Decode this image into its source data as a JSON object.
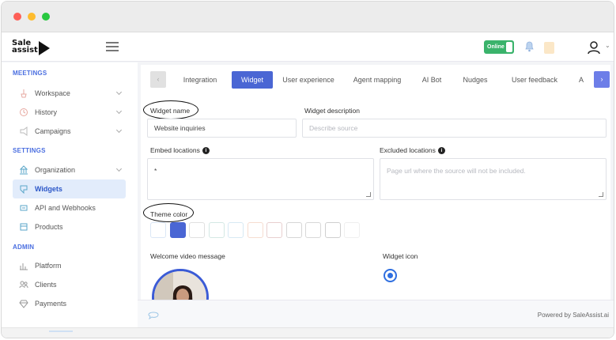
{
  "app": {
    "logo_text": "Sale assist"
  },
  "topbar": {
    "status_label": "Online"
  },
  "sidebar": {
    "sections": [
      {
        "title": "MEETINGS",
        "items": [
          {
            "label": "Workspace",
            "icon": "workspace-icon"
          },
          {
            "label": "History",
            "icon": "history-icon"
          },
          {
            "label": "Campaigns",
            "icon": "campaigns-icon"
          }
        ]
      },
      {
        "title": "SETTINGS",
        "items": [
          {
            "label": "Organization",
            "icon": "organization-icon"
          },
          {
            "label": "Widgets",
            "icon": "widgets-icon"
          },
          {
            "label": "API and Webhooks",
            "icon": "api-icon"
          },
          {
            "label": "Products",
            "icon": "products-icon"
          }
        ]
      },
      {
        "title": "ADMIN",
        "items": [
          {
            "label": "Platform",
            "icon": "platform-icon"
          },
          {
            "label": "Clients",
            "icon": "clients-icon"
          },
          {
            "label": "Payments",
            "icon": "payments-icon"
          }
        ]
      }
    ]
  },
  "tabs": [
    "Integration",
    "Widget",
    "User experience",
    "Agent mapping",
    "AI Bot",
    "Nudges",
    "User feedback",
    "A"
  ],
  "tabs_nav": {
    "prev": "‹",
    "next": "›"
  },
  "form": {
    "widget_name_label": "Widget name",
    "widget_name_value": "Website inquiries",
    "widget_description_label": "Widget description",
    "widget_description_placeholder": "Describe source",
    "embed_locations_label": "Embed locations",
    "embed_locations_value": "*",
    "excluded_locations_label": "Excluded locations",
    "excluded_locations_placeholder": "Page url where the source will not be included.",
    "theme_color_label": "Theme color",
    "theme_colors": [
      "#dbe7f6",
      "#4a66d4",
      "#e0e0e0",
      "#d4e8e4",
      "#d7e9f4",
      "#f6ddd0",
      "#e8cfcf",
      "#d6d6d6",
      "#d8d8d8",
      "#cfcfcf",
      "#efefef"
    ],
    "welcome_video_label": "Welcome video message",
    "widget_icon_label": "Widget icon",
    "info_glyph": "i"
  },
  "footer": {
    "powered_by": "Powered by SaleAssist.ai"
  }
}
